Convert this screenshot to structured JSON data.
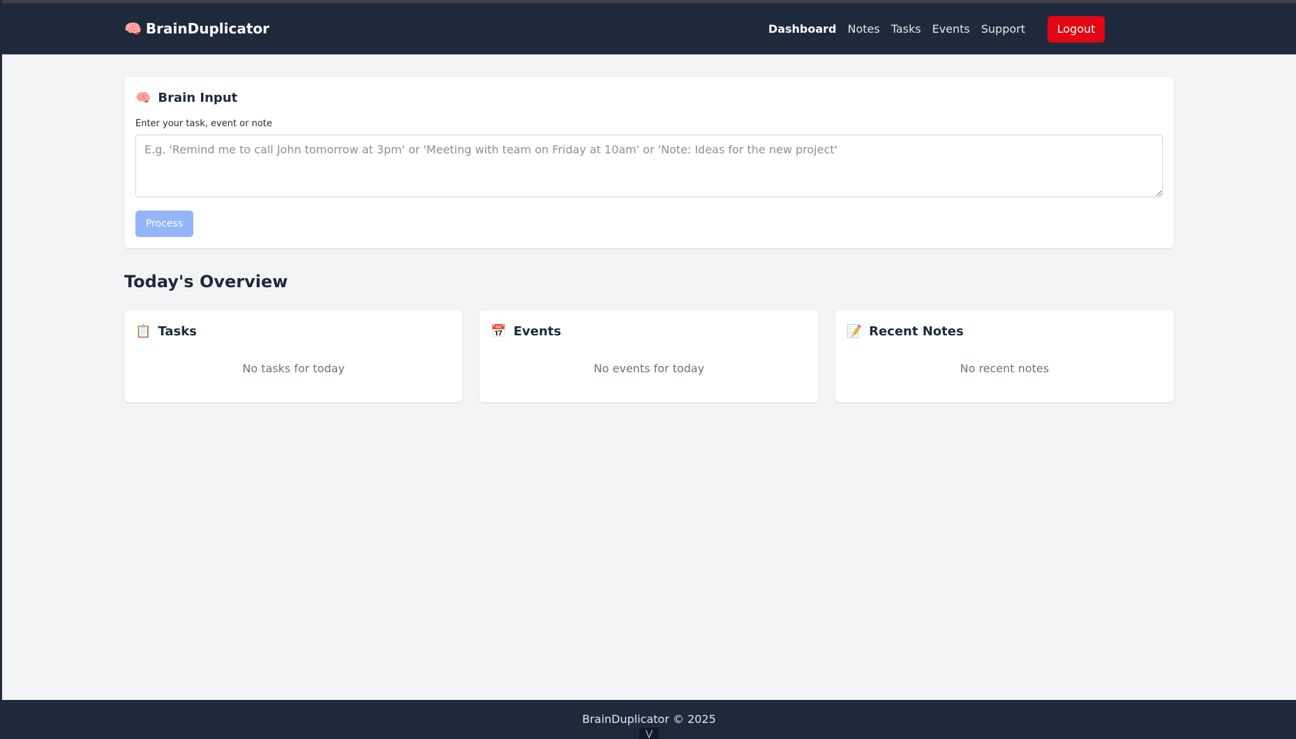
{
  "navbar": {
    "brand_icon": "🧠",
    "brand_name": "BrainDuplicator",
    "links": [
      {
        "label": "Dashboard",
        "active": true
      },
      {
        "label": "Notes",
        "active": false
      },
      {
        "label": "Tasks",
        "active": false
      },
      {
        "label": "Events",
        "active": false
      },
      {
        "label": "Support",
        "active": false
      }
    ],
    "logout_label": "Logout"
  },
  "brain_input": {
    "icon": "🧠",
    "title": "Brain Input",
    "field_label": "Enter your task, event or note",
    "placeholder": "E.g. 'Remind me to call John tomorrow at 3pm' or 'Meeting with team on Friday at 10am' or 'Note: Ideas for the new project'",
    "value": "",
    "process_label": "Process"
  },
  "overview": {
    "heading": "Today's Overview",
    "cards": [
      {
        "icon": "📋",
        "title": "Tasks",
        "empty": "No tasks for today"
      },
      {
        "icon": "📅",
        "title": "Events",
        "empty": "No events for today"
      },
      {
        "icon": "📝",
        "title": "Recent Notes",
        "empty": "No recent notes"
      }
    ]
  },
  "footer": {
    "text": "BrainDuplicator © 2025",
    "scroll_hint": "⋁"
  },
  "colors": {
    "navbar_bg": "#1e293b",
    "logout_bg": "#e30613",
    "process_bg": "#93b4f9",
    "page_bg": "#f3f4f6"
  }
}
